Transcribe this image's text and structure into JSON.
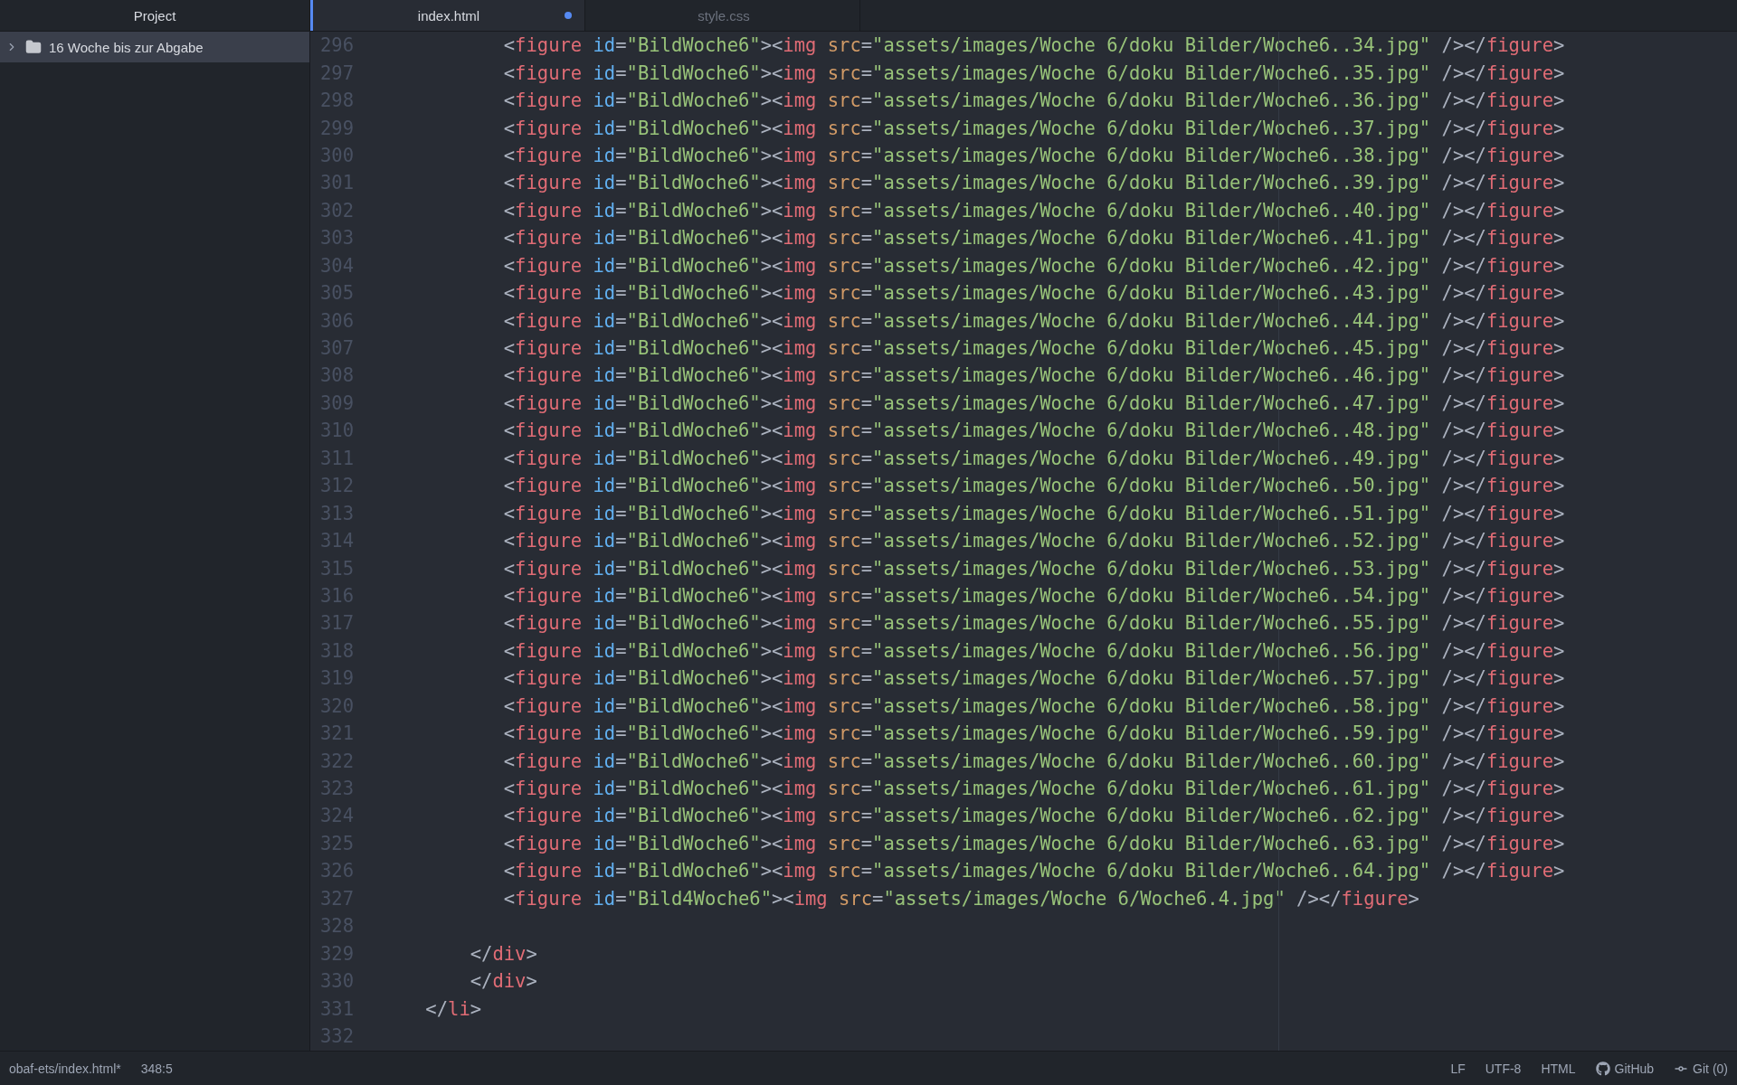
{
  "sidebar": {
    "title": "Project",
    "items": [
      {
        "label": "16 Woche bis zur Abgabe",
        "expanded": false,
        "selected": true
      }
    ]
  },
  "tabs": [
    {
      "label": "index.html",
      "selected": true,
      "modified": true
    },
    {
      "label": "style.css",
      "selected": false,
      "modified": false
    }
  ],
  "editor": {
    "lines": [
      {
        "number": "296",
        "tokens": [
          {
            "kind": "punct",
            "text": "           <"
          },
          {
            "kind": "tag",
            "text": "figure"
          },
          {
            "kind": "id",
            "text": " id"
          },
          {
            "kind": "punct",
            "text": "="
          },
          {
            "kind": "string",
            "text": "\"BildWoche6\""
          },
          {
            "kind": "punct",
            "text": "><"
          },
          {
            "kind": "tag",
            "text": "img"
          },
          {
            "kind": "attr",
            "text": " src"
          },
          {
            "kind": "punct",
            "text": "="
          },
          {
            "kind": "string",
            "text": "\"assets/images/Woche 6/doku Bilder/Woche6..34.jpg\""
          },
          {
            "kind": "punct",
            "text": " /></"
          },
          {
            "kind": "tag",
            "text": "figure"
          },
          {
            "kind": "punct",
            "text": ">"
          }
        ]
      },
      {
        "number": "297",
        "tokens": [
          {
            "kind": "punct",
            "text": "           <"
          },
          {
            "kind": "tag",
            "text": "figure"
          },
          {
            "kind": "id",
            "text": " id"
          },
          {
            "kind": "punct",
            "text": "="
          },
          {
            "kind": "string",
            "text": "\"BildWoche6\""
          },
          {
            "kind": "punct",
            "text": "><"
          },
          {
            "kind": "tag",
            "text": "img"
          },
          {
            "kind": "attr",
            "text": " src"
          },
          {
            "kind": "punct",
            "text": "="
          },
          {
            "kind": "string",
            "text": "\"assets/images/Woche 6/doku Bilder/Woche6..35.jpg\""
          },
          {
            "kind": "punct",
            "text": " /></"
          },
          {
            "kind": "tag",
            "text": "figure"
          },
          {
            "kind": "punct",
            "text": ">"
          }
        ]
      },
      {
        "number": "298",
        "tokens": [
          {
            "kind": "punct",
            "text": "           <"
          },
          {
            "kind": "tag",
            "text": "figure"
          },
          {
            "kind": "id",
            "text": " id"
          },
          {
            "kind": "punct",
            "text": "="
          },
          {
            "kind": "string",
            "text": "\"BildWoche6\""
          },
          {
            "kind": "punct",
            "text": "><"
          },
          {
            "kind": "tag",
            "text": "img"
          },
          {
            "kind": "attr",
            "text": " src"
          },
          {
            "kind": "punct",
            "text": "="
          },
          {
            "kind": "string",
            "text": "\"assets/images/Woche 6/doku Bilder/Woche6..36.jpg\""
          },
          {
            "kind": "punct",
            "text": " /></"
          },
          {
            "kind": "tag",
            "text": "figure"
          },
          {
            "kind": "punct",
            "text": ">"
          }
        ]
      },
      {
        "number": "299",
        "tokens": [
          {
            "kind": "punct",
            "text": "           <"
          },
          {
            "kind": "tag",
            "text": "figure"
          },
          {
            "kind": "id",
            "text": " id"
          },
          {
            "kind": "punct",
            "text": "="
          },
          {
            "kind": "string",
            "text": "\"BildWoche6\""
          },
          {
            "kind": "punct",
            "text": "><"
          },
          {
            "kind": "tag",
            "text": "img"
          },
          {
            "kind": "attr",
            "text": " src"
          },
          {
            "kind": "punct",
            "text": "="
          },
          {
            "kind": "string",
            "text": "\"assets/images/Woche 6/doku Bilder/Woche6..37.jpg\""
          },
          {
            "kind": "punct",
            "text": " /></"
          },
          {
            "kind": "tag",
            "text": "figure"
          },
          {
            "kind": "punct",
            "text": ">"
          }
        ]
      },
      {
        "number": "300",
        "tokens": [
          {
            "kind": "punct",
            "text": "           <"
          },
          {
            "kind": "tag",
            "text": "figure"
          },
          {
            "kind": "id",
            "text": " id"
          },
          {
            "kind": "punct",
            "text": "="
          },
          {
            "kind": "string",
            "text": "\"BildWoche6\""
          },
          {
            "kind": "punct",
            "text": "><"
          },
          {
            "kind": "tag",
            "text": "img"
          },
          {
            "kind": "attr",
            "text": " src"
          },
          {
            "kind": "punct",
            "text": "="
          },
          {
            "kind": "string",
            "text": "\"assets/images/Woche 6/doku Bilder/Woche6..38.jpg\""
          },
          {
            "kind": "punct",
            "text": " /></"
          },
          {
            "kind": "tag",
            "text": "figure"
          },
          {
            "kind": "punct",
            "text": ">"
          }
        ]
      },
      {
        "number": "301",
        "tokens": [
          {
            "kind": "punct",
            "text": "           <"
          },
          {
            "kind": "tag",
            "text": "figure"
          },
          {
            "kind": "id",
            "text": " id"
          },
          {
            "kind": "punct",
            "text": "="
          },
          {
            "kind": "string",
            "text": "\"BildWoche6\""
          },
          {
            "kind": "punct",
            "text": "><"
          },
          {
            "kind": "tag",
            "text": "img"
          },
          {
            "kind": "attr",
            "text": " src"
          },
          {
            "kind": "punct",
            "text": "="
          },
          {
            "kind": "string",
            "text": "\"assets/images/Woche 6/doku Bilder/Woche6..39.jpg\""
          },
          {
            "kind": "punct",
            "text": " /></"
          },
          {
            "kind": "tag",
            "text": "figure"
          },
          {
            "kind": "punct",
            "text": ">"
          }
        ]
      },
      {
        "number": "302",
        "tokens": [
          {
            "kind": "punct",
            "text": "           <"
          },
          {
            "kind": "tag",
            "text": "figure"
          },
          {
            "kind": "id",
            "text": " id"
          },
          {
            "kind": "punct",
            "text": "="
          },
          {
            "kind": "string",
            "text": "\"BildWoche6\""
          },
          {
            "kind": "punct",
            "text": "><"
          },
          {
            "kind": "tag",
            "text": "img"
          },
          {
            "kind": "attr",
            "text": " src"
          },
          {
            "kind": "punct",
            "text": "="
          },
          {
            "kind": "string",
            "text": "\"assets/images/Woche 6/doku Bilder/Woche6..40.jpg\""
          },
          {
            "kind": "punct",
            "text": " /></"
          },
          {
            "kind": "tag",
            "text": "figure"
          },
          {
            "kind": "punct",
            "text": ">"
          }
        ]
      },
      {
        "number": "303",
        "tokens": [
          {
            "kind": "punct",
            "text": "           <"
          },
          {
            "kind": "tag",
            "text": "figure"
          },
          {
            "kind": "id",
            "text": " id"
          },
          {
            "kind": "punct",
            "text": "="
          },
          {
            "kind": "string",
            "text": "\"BildWoche6\""
          },
          {
            "kind": "punct",
            "text": "><"
          },
          {
            "kind": "tag",
            "text": "img"
          },
          {
            "kind": "attr",
            "text": " src"
          },
          {
            "kind": "punct",
            "text": "="
          },
          {
            "kind": "string",
            "text": "\"assets/images/Woche 6/doku Bilder/Woche6..41.jpg\""
          },
          {
            "kind": "punct",
            "text": " /></"
          },
          {
            "kind": "tag",
            "text": "figure"
          },
          {
            "kind": "punct",
            "text": ">"
          }
        ]
      },
      {
        "number": "304",
        "tokens": [
          {
            "kind": "punct",
            "text": "           <"
          },
          {
            "kind": "tag",
            "text": "figure"
          },
          {
            "kind": "id",
            "text": " id"
          },
          {
            "kind": "punct",
            "text": "="
          },
          {
            "kind": "string",
            "text": "\"BildWoche6\""
          },
          {
            "kind": "punct",
            "text": "><"
          },
          {
            "kind": "tag",
            "text": "img"
          },
          {
            "kind": "attr",
            "text": " src"
          },
          {
            "kind": "punct",
            "text": "="
          },
          {
            "kind": "string",
            "text": "\"assets/images/Woche 6/doku Bilder/Woche6..42.jpg\""
          },
          {
            "kind": "punct",
            "text": " /></"
          },
          {
            "kind": "tag",
            "text": "figure"
          },
          {
            "kind": "punct",
            "text": ">"
          }
        ]
      },
      {
        "number": "305",
        "tokens": [
          {
            "kind": "punct",
            "text": "           <"
          },
          {
            "kind": "tag",
            "text": "figure"
          },
          {
            "kind": "id",
            "text": " id"
          },
          {
            "kind": "punct",
            "text": "="
          },
          {
            "kind": "string",
            "text": "\"BildWoche6\""
          },
          {
            "kind": "punct",
            "text": "><"
          },
          {
            "kind": "tag",
            "text": "img"
          },
          {
            "kind": "attr",
            "text": " src"
          },
          {
            "kind": "punct",
            "text": "="
          },
          {
            "kind": "string",
            "text": "\"assets/images/Woche 6/doku Bilder/Woche6..43.jpg\""
          },
          {
            "kind": "punct",
            "text": " /></"
          },
          {
            "kind": "tag",
            "text": "figure"
          },
          {
            "kind": "punct",
            "text": ">"
          }
        ]
      },
      {
        "number": "306",
        "tokens": [
          {
            "kind": "punct",
            "text": "           <"
          },
          {
            "kind": "tag",
            "text": "figure"
          },
          {
            "kind": "id",
            "text": " id"
          },
          {
            "kind": "punct",
            "text": "="
          },
          {
            "kind": "string",
            "text": "\"BildWoche6\""
          },
          {
            "kind": "punct",
            "text": "><"
          },
          {
            "kind": "tag",
            "text": "img"
          },
          {
            "kind": "attr",
            "text": " src"
          },
          {
            "kind": "punct",
            "text": "="
          },
          {
            "kind": "string",
            "text": "\"assets/images/Woche 6/doku Bilder/Woche6..44.jpg\""
          },
          {
            "kind": "punct",
            "text": " /></"
          },
          {
            "kind": "tag",
            "text": "figure"
          },
          {
            "kind": "punct",
            "text": ">"
          }
        ]
      },
      {
        "number": "307",
        "tokens": [
          {
            "kind": "punct",
            "text": "           <"
          },
          {
            "kind": "tag",
            "text": "figure"
          },
          {
            "kind": "id",
            "text": " id"
          },
          {
            "kind": "punct",
            "text": "="
          },
          {
            "kind": "string",
            "text": "\"BildWoche6\""
          },
          {
            "kind": "punct",
            "text": "><"
          },
          {
            "kind": "tag",
            "text": "img"
          },
          {
            "kind": "attr",
            "text": " src"
          },
          {
            "kind": "punct",
            "text": "="
          },
          {
            "kind": "string",
            "text": "\"assets/images/Woche 6/doku Bilder/Woche6..45.jpg\""
          },
          {
            "kind": "punct",
            "text": " /></"
          },
          {
            "kind": "tag",
            "text": "figure"
          },
          {
            "kind": "punct",
            "text": ">"
          }
        ]
      },
      {
        "number": "308",
        "tokens": [
          {
            "kind": "punct",
            "text": "           <"
          },
          {
            "kind": "tag",
            "text": "figure"
          },
          {
            "kind": "id",
            "text": " id"
          },
          {
            "kind": "punct",
            "text": "="
          },
          {
            "kind": "string",
            "text": "\"BildWoche6\""
          },
          {
            "kind": "punct",
            "text": "><"
          },
          {
            "kind": "tag",
            "text": "img"
          },
          {
            "kind": "attr",
            "text": " src"
          },
          {
            "kind": "punct",
            "text": "="
          },
          {
            "kind": "string",
            "text": "\"assets/images/Woche 6/doku Bilder/Woche6..46.jpg\""
          },
          {
            "kind": "punct",
            "text": " /></"
          },
          {
            "kind": "tag",
            "text": "figure"
          },
          {
            "kind": "punct",
            "text": ">"
          }
        ]
      },
      {
        "number": "309",
        "tokens": [
          {
            "kind": "punct",
            "text": "           <"
          },
          {
            "kind": "tag",
            "text": "figure"
          },
          {
            "kind": "id",
            "text": " id"
          },
          {
            "kind": "punct",
            "text": "="
          },
          {
            "kind": "string",
            "text": "\"BildWoche6\""
          },
          {
            "kind": "punct",
            "text": "><"
          },
          {
            "kind": "tag",
            "text": "img"
          },
          {
            "kind": "attr",
            "text": " src"
          },
          {
            "kind": "punct",
            "text": "="
          },
          {
            "kind": "string",
            "text": "\"assets/images/Woche 6/doku Bilder/Woche6..47.jpg\""
          },
          {
            "kind": "punct",
            "text": " /></"
          },
          {
            "kind": "tag",
            "text": "figure"
          },
          {
            "kind": "punct",
            "text": ">"
          }
        ]
      },
      {
        "number": "310",
        "tokens": [
          {
            "kind": "punct",
            "text": "           <"
          },
          {
            "kind": "tag",
            "text": "figure"
          },
          {
            "kind": "id",
            "text": " id"
          },
          {
            "kind": "punct",
            "text": "="
          },
          {
            "kind": "string",
            "text": "\"BildWoche6\""
          },
          {
            "kind": "punct",
            "text": "><"
          },
          {
            "kind": "tag",
            "text": "img"
          },
          {
            "kind": "attr",
            "text": " src"
          },
          {
            "kind": "punct",
            "text": "="
          },
          {
            "kind": "string",
            "text": "\"assets/images/Woche 6/doku Bilder/Woche6..48.jpg\""
          },
          {
            "kind": "punct",
            "text": " /></"
          },
          {
            "kind": "tag",
            "text": "figure"
          },
          {
            "kind": "punct",
            "text": ">"
          }
        ]
      },
      {
        "number": "311",
        "tokens": [
          {
            "kind": "punct",
            "text": "           <"
          },
          {
            "kind": "tag",
            "text": "figure"
          },
          {
            "kind": "id",
            "text": " id"
          },
          {
            "kind": "punct",
            "text": "="
          },
          {
            "kind": "string",
            "text": "\"BildWoche6\""
          },
          {
            "kind": "punct",
            "text": "><"
          },
          {
            "kind": "tag",
            "text": "img"
          },
          {
            "kind": "attr",
            "text": " src"
          },
          {
            "kind": "punct",
            "text": "="
          },
          {
            "kind": "string",
            "text": "\"assets/images/Woche 6/doku Bilder/Woche6..49.jpg\""
          },
          {
            "kind": "punct",
            "text": " /></"
          },
          {
            "kind": "tag",
            "text": "figure"
          },
          {
            "kind": "punct",
            "text": ">"
          }
        ]
      },
      {
        "number": "312",
        "tokens": [
          {
            "kind": "punct",
            "text": "           <"
          },
          {
            "kind": "tag",
            "text": "figure"
          },
          {
            "kind": "id",
            "text": " id"
          },
          {
            "kind": "punct",
            "text": "="
          },
          {
            "kind": "string",
            "text": "\"BildWoche6\""
          },
          {
            "kind": "punct",
            "text": "><"
          },
          {
            "kind": "tag",
            "text": "img"
          },
          {
            "kind": "attr",
            "text": " src"
          },
          {
            "kind": "punct",
            "text": "="
          },
          {
            "kind": "string",
            "text": "\"assets/images/Woche 6/doku Bilder/Woche6..50.jpg\""
          },
          {
            "kind": "punct",
            "text": " /></"
          },
          {
            "kind": "tag",
            "text": "figure"
          },
          {
            "kind": "punct",
            "text": ">"
          }
        ]
      },
      {
        "number": "313",
        "tokens": [
          {
            "kind": "punct",
            "text": "           <"
          },
          {
            "kind": "tag",
            "text": "figure"
          },
          {
            "kind": "id",
            "text": " id"
          },
          {
            "kind": "punct",
            "text": "="
          },
          {
            "kind": "string",
            "text": "\"BildWoche6\""
          },
          {
            "kind": "punct",
            "text": "><"
          },
          {
            "kind": "tag",
            "text": "img"
          },
          {
            "kind": "attr",
            "text": " src"
          },
          {
            "kind": "punct",
            "text": "="
          },
          {
            "kind": "string",
            "text": "\"assets/images/Woche 6/doku Bilder/Woche6..51.jpg\""
          },
          {
            "kind": "punct",
            "text": " /></"
          },
          {
            "kind": "tag",
            "text": "figure"
          },
          {
            "kind": "punct",
            "text": ">"
          }
        ]
      },
      {
        "number": "314",
        "tokens": [
          {
            "kind": "punct",
            "text": "           <"
          },
          {
            "kind": "tag",
            "text": "figure"
          },
          {
            "kind": "id",
            "text": " id"
          },
          {
            "kind": "punct",
            "text": "="
          },
          {
            "kind": "string",
            "text": "\"BildWoche6\""
          },
          {
            "kind": "punct",
            "text": "><"
          },
          {
            "kind": "tag",
            "text": "img"
          },
          {
            "kind": "attr",
            "text": " src"
          },
          {
            "kind": "punct",
            "text": "="
          },
          {
            "kind": "string",
            "text": "\"assets/images/Woche 6/doku Bilder/Woche6..52.jpg\""
          },
          {
            "kind": "punct",
            "text": " /></"
          },
          {
            "kind": "tag",
            "text": "figure"
          },
          {
            "kind": "punct",
            "text": ">"
          }
        ]
      },
      {
        "number": "315",
        "tokens": [
          {
            "kind": "punct",
            "text": "           <"
          },
          {
            "kind": "tag",
            "text": "figure"
          },
          {
            "kind": "id",
            "text": " id"
          },
          {
            "kind": "punct",
            "text": "="
          },
          {
            "kind": "string",
            "text": "\"BildWoche6\""
          },
          {
            "kind": "punct",
            "text": "><"
          },
          {
            "kind": "tag",
            "text": "img"
          },
          {
            "kind": "attr",
            "text": " src"
          },
          {
            "kind": "punct",
            "text": "="
          },
          {
            "kind": "string",
            "text": "\"assets/images/Woche 6/doku Bilder/Woche6..53.jpg\""
          },
          {
            "kind": "punct",
            "text": " /></"
          },
          {
            "kind": "tag",
            "text": "figure"
          },
          {
            "kind": "punct",
            "text": ">"
          }
        ]
      },
      {
        "number": "316",
        "tokens": [
          {
            "kind": "punct",
            "text": "           <"
          },
          {
            "kind": "tag",
            "text": "figure"
          },
          {
            "kind": "id",
            "text": " id"
          },
          {
            "kind": "punct",
            "text": "="
          },
          {
            "kind": "string",
            "text": "\"BildWoche6\""
          },
          {
            "kind": "punct",
            "text": "><"
          },
          {
            "kind": "tag",
            "text": "img"
          },
          {
            "kind": "attr",
            "text": " src"
          },
          {
            "kind": "punct",
            "text": "="
          },
          {
            "kind": "string",
            "text": "\"assets/images/Woche 6/doku Bilder/Woche6..54.jpg\""
          },
          {
            "kind": "punct",
            "text": " /></"
          },
          {
            "kind": "tag",
            "text": "figure"
          },
          {
            "kind": "punct",
            "text": ">"
          }
        ]
      },
      {
        "number": "317",
        "tokens": [
          {
            "kind": "punct",
            "text": "           <"
          },
          {
            "kind": "tag",
            "text": "figure"
          },
          {
            "kind": "id",
            "text": " id"
          },
          {
            "kind": "punct",
            "text": "="
          },
          {
            "kind": "string",
            "text": "\"BildWoche6\""
          },
          {
            "kind": "punct",
            "text": "><"
          },
          {
            "kind": "tag",
            "text": "img"
          },
          {
            "kind": "attr",
            "text": " src"
          },
          {
            "kind": "punct",
            "text": "="
          },
          {
            "kind": "string",
            "text": "\"assets/images/Woche 6/doku Bilder/Woche6..55.jpg\""
          },
          {
            "kind": "punct",
            "text": " /></"
          },
          {
            "kind": "tag",
            "text": "figure"
          },
          {
            "kind": "punct",
            "text": ">"
          }
        ]
      },
      {
        "number": "318",
        "tokens": [
          {
            "kind": "punct",
            "text": "           <"
          },
          {
            "kind": "tag",
            "text": "figure"
          },
          {
            "kind": "id",
            "text": " id"
          },
          {
            "kind": "punct",
            "text": "="
          },
          {
            "kind": "string",
            "text": "\"BildWoche6\""
          },
          {
            "kind": "punct",
            "text": "><"
          },
          {
            "kind": "tag",
            "text": "img"
          },
          {
            "kind": "attr",
            "text": " src"
          },
          {
            "kind": "punct",
            "text": "="
          },
          {
            "kind": "string",
            "text": "\"assets/images/Woche 6/doku Bilder/Woche6..56.jpg\""
          },
          {
            "kind": "punct",
            "text": " /></"
          },
          {
            "kind": "tag",
            "text": "figure"
          },
          {
            "kind": "punct",
            "text": ">"
          }
        ]
      },
      {
        "number": "319",
        "tokens": [
          {
            "kind": "punct",
            "text": "           <"
          },
          {
            "kind": "tag",
            "text": "figure"
          },
          {
            "kind": "id",
            "text": " id"
          },
          {
            "kind": "punct",
            "text": "="
          },
          {
            "kind": "string",
            "text": "\"BildWoche6\""
          },
          {
            "kind": "punct",
            "text": "><"
          },
          {
            "kind": "tag",
            "text": "img"
          },
          {
            "kind": "attr",
            "text": " src"
          },
          {
            "kind": "punct",
            "text": "="
          },
          {
            "kind": "string",
            "text": "\"assets/images/Woche 6/doku Bilder/Woche6..57.jpg\""
          },
          {
            "kind": "punct",
            "text": " /></"
          },
          {
            "kind": "tag",
            "text": "figure"
          },
          {
            "kind": "punct",
            "text": ">"
          }
        ]
      },
      {
        "number": "320",
        "tokens": [
          {
            "kind": "punct",
            "text": "           <"
          },
          {
            "kind": "tag",
            "text": "figure"
          },
          {
            "kind": "id",
            "text": " id"
          },
          {
            "kind": "punct",
            "text": "="
          },
          {
            "kind": "string",
            "text": "\"BildWoche6\""
          },
          {
            "kind": "punct",
            "text": "><"
          },
          {
            "kind": "tag",
            "text": "img"
          },
          {
            "kind": "attr",
            "text": " src"
          },
          {
            "kind": "punct",
            "text": "="
          },
          {
            "kind": "string",
            "text": "\"assets/images/Woche 6/doku Bilder/Woche6..58.jpg\""
          },
          {
            "kind": "punct",
            "text": " /></"
          },
          {
            "kind": "tag",
            "text": "figure"
          },
          {
            "kind": "punct",
            "text": ">"
          }
        ]
      },
      {
        "number": "321",
        "tokens": [
          {
            "kind": "punct",
            "text": "           <"
          },
          {
            "kind": "tag",
            "text": "figure"
          },
          {
            "kind": "id",
            "text": " id"
          },
          {
            "kind": "punct",
            "text": "="
          },
          {
            "kind": "string",
            "text": "\"BildWoche6\""
          },
          {
            "kind": "punct",
            "text": "><"
          },
          {
            "kind": "tag",
            "text": "img"
          },
          {
            "kind": "attr",
            "text": " src"
          },
          {
            "kind": "punct",
            "text": "="
          },
          {
            "kind": "string",
            "text": "\"assets/images/Woche 6/doku Bilder/Woche6..59.jpg\""
          },
          {
            "kind": "punct",
            "text": " /></"
          },
          {
            "kind": "tag",
            "text": "figure"
          },
          {
            "kind": "punct",
            "text": ">"
          }
        ]
      },
      {
        "number": "322",
        "tokens": [
          {
            "kind": "punct",
            "text": "           <"
          },
          {
            "kind": "tag",
            "text": "figure"
          },
          {
            "kind": "id",
            "text": " id"
          },
          {
            "kind": "punct",
            "text": "="
          },
          {
            "kind": "string",
            "text": "\"BildWoche6\""
          },
          {
            "kind": "punct",
            "text": "><"
          },
          {
            "kind": "tag",
            "text": "img"
          },
          {
            "kind": "attr",
            "text": " src"
          },
          {
            "kind": "punct",
            "text": "="
          },
          {
            "kind": "string",
            "text": "\"assets/images/Woche 6/doku Bilder/Woche6..60.jpg\""
          },
          {
            "kind": "punct",
            "text": " /></"
          },
          {
            "kind": "tag",
            "text": "figure"
          },
          {
            "kind": "punct",
            "text": ">"
          }
        ]
      },
      {
        "number": "323",
        "tokens": [
          {
            "kind": "punct",
            "text": "           <"
          },
          {
            "kind": "tag",
            "text": "figure"
          },
          {
            "kind": "id",
            "text": " id"
          },
          {
            "kind": "punct",
            "text": "="
          },
          {
            "kind": "string",
            "text": "\"BildWoche6\""
          },
          {
            "kind": "punct",
            "text": "><"
          },
          {
            "kind": "tag",
            "text": "img"
          },
          {
            "kind": "attr",
            "text": " src"
          },
          {
            "kind": "punct",
            "text": "="
          },
          {
            "kind": "string",
            "text": "\"assets/images/Woche 6/doku Bilder/Woche6..61.jpg\""
          },
          {
            "kind": "punct",
            "text": " /></"
          },
          {
            "kind": "tag",
            "text": "figure"
          },
          {
            "kind": "punct",
            "text": ">"
          }
        ]
      },
      {
        "number": "324",
        "tokens": [
          {
            "kind": "punct",
            "text": "           <"
          },
          {
            "kind": "tag",
            "text": "figure"
          },
          {
            "kind": "id",
            "text": " id"
          },
          {
            "kind": "punct",
            "text": "="
          },
          {
            "kind": "string",
            "text": "\"BildWoche6\""
          },
          {
            "kind": "punct",
            "text": "><"
          },
          {
            "kind": "tag",
            "text": "img"
          },
          {
            "kind": "attr",
            "text": " src"
          },
          {
            "kind": "punct",
            "text": "="
          },
          {
            "kind": "string",
            "text": "\"assets/images/Woche 6/doku Bilder/Woche6..62.jpg\""
          },
          {
            "kind": "punct",
            "text": " /></"
          },
          {
            "kind": "tag",
            "text": "figure"
          },
          {
            "kind": "punct",
            "text": ">"
          }
        ]
      },
      {
        "number": "325",
        "tokens": [
          {
            "kind": "punct",
            "text": "           <"
          },
          {
            "kind": "tag",
            "text": "figure"
          },
          {
            "kind": "id",
            "text": " id"
          },
          {
            "kind": "punct",
            "text": "="
          },
          {
            "kind": "string",
            "text": "\"BildWoche6\""
          },
          {
            "kind": "punct",
            "text": "><"
          },
          {
            "kind": "tag",
            "text": "img"
          },
          {
            "kind": "attr",
            "text": " src"
          },
          {
            "kind": "punct",
            "text": "="
          },
          {
            "kind": "string",
            "text": "\"assets/images/Woche 6/doku Bilder/Woche6..63.jpg\""
          },
          {
            "kind": "punct",
            "text": " /></"
          },
          {
            "kind": "tag",
            "text": "figure"
          },
          {
            "kind": "punct",
            "text": ">"
          }
        ]
      },
      {
        "number": "326",
        "tokens": [
          {
            "kind": "punct",
            "text": "           <"
          },
          {
            "kind": "tag",
            "text": "figure"
          },
          {
            "kind": "id",
            "text": " id"
          },
          {
            "kind": "punct",
            "text": "="
          },
          {
            "kind": "string",
            "text": "\"BildWoche6\""
          },
          {
            "kind": "punct",
            "text": "><"
          },
          {
            "kind": "tag",
            "text": "img"
          },
          {
            "kind": "attr",
            "text": " src"
          },
          {
            "kind": "punct",
            "text": "="
          },
          {
            "kind": "string",
            "text": "\"assets/images/Woche 6/doku Bilder/Woche6..64.jpg\""
          },
          {
            "kind": "punct",
            "text": " /></"
          },
          {
            "kind": "tag",
            "text": "figure"
          },
          {
            "kind": "punct",
            "text": ">"
          }
        ]
      },
      {
        "number": "327",
        "tokens": [
          {
            "kind": "punct",
            "text": "           <"
          },
          {
            "kind": "tag",
            "text": "figure"
          },
          {
            "kind": "id",
            "text": " id"
          },
          {
            "kind": "punct",
            "text": "="
          },
          {
            "kind": "string",
            "text": "\"Bild4Woche6\""
          },
          {
            "kind": "punct",
            "text": "><"
          },
          {
            "kind": "tag",
            "text": "img"
          },
          {
            "kind": "attr",
            "text": " src"
          },
          {
            "kind": "punct",
            "text": "="
          },
          {
            "kind": "string",
            "text": "\"assets/images/Woche 6/Woche6.4.jpg\""
          },
          {
            "kind": "punct",
            "text": " /></"
          },
          {
            "kind": "tag",
            "text": "figure"
          },
          {
            "kind": "punct",
            "text": ">"
          }
        ]
      },
      {
        "number": "328"
      },
      {
        "number": "329",
        "tokens": [
          {
            "kind": "punct",
            "text": "        </"
          },
          {
            "kind": "tag",
            "text": "div"
          },
          {
            "kind": "punct",
            "text": ">"
          }
        ]
      },
      {
        "number": "330",
        "tokens": [
          {
            "kind": "punct",
            "text": "        </"
          },
          {
            "kind": "tag",
            "text": "div"
          },
          {
            "kind": "punct",
            "text": ">"
          }
        ]
      },
      {
        "number": "331",
        "tokens": [
          {
            "kind": "punct",
            "text": "    </"
          },
          {
            "kind": "tag",
            "text": "li"
          },
          {
            "kind": "punct",
            "text": ">"
          }
        ]
      },
      {
        "number": "332"
      }
    ]
  },
  "status_bar": {
    "file": "obaf-ets/index.html*",
    "cursor": "348:5",
    "line_ending": "LF",
    "encoding": "UTF-8",
    "grammar": "HTML",
    "github": "GitHub",
    "git": "Git (0)"
  }
}
